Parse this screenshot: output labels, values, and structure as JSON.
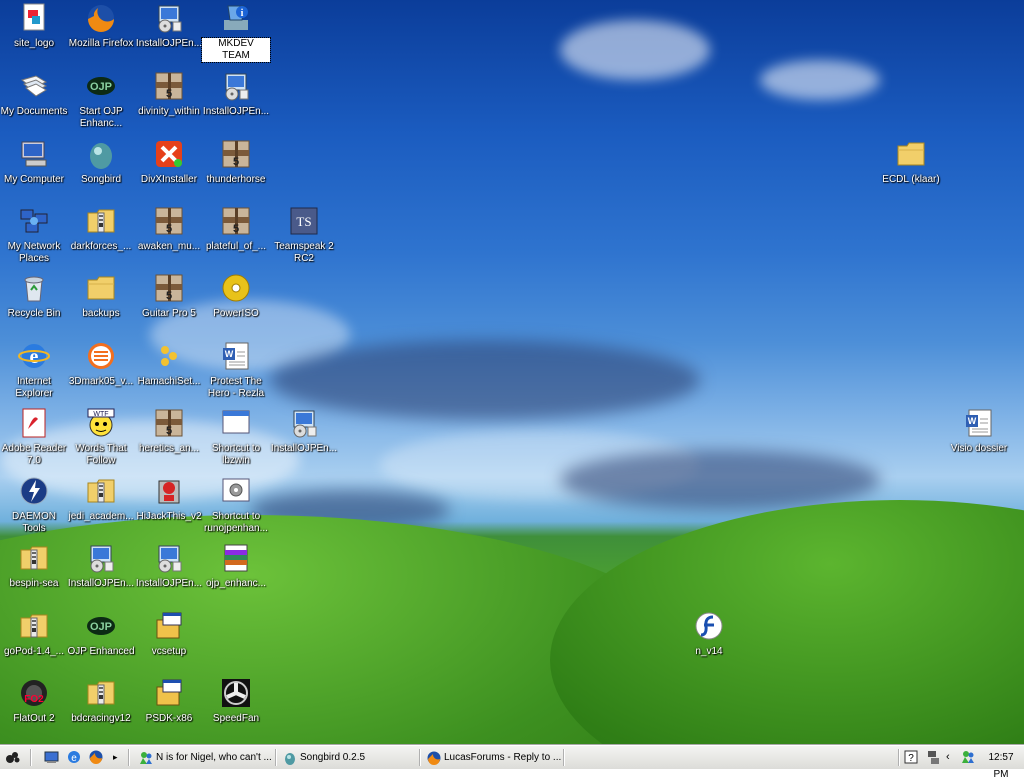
{
  "desktop": {
    "icons": [
      {
        "label": "site_logo",
        "icon": "site-logo-icon"
      },
      {
        "label": "Mozilla Firefox",
        "icon": "firefox-icon"
      },
      {
        "label": "InstallOJPEn...",
        "icon": "installer-icon"
      },
      {
        "label": "MKDEV TEAM",
        "icon": "info-icon"
      },
      {
        "label": "My Documents",
        "icon": "my-documents-icon"
      },
      {
        "label": "Start OJP Enhanc...",
        "icon": "ojp-icon"
      },
      {
        "label": "divinity_within",
        "icon": "guitar-pro-file-icon"
      },
      {
        "label": "InstallOJPEn...",
        "icon": "installer-icon"
      },
      {
        "label": "My Computer",
        "icon": "my-computer-icon"
      },
      {
        "label": "Songbird",
        "icon": "songbird-icon"
      },
      {
        "label": "DivXInstaller",
        "icon": "divx-icon"
      },
      {
        "label": "thunderhorse",
        "icon": "guitar-pro-file-icon"
      },
      {
        "label": "My Network Places",
        "icon": "network-places-icon"
      },
      {
        "label": "darkforces_...",
        "icon": "zip-folder-icon"
      },
      {
        "label": "awaken_mu...",
        "icon": "guitar-pro-file-icon"
      },
      {
        "label": "plateful_of_...",
        "icon": "guitar-pro-file-icon"
      },
      {
        "label": "Teamspeak 2 RC2",
        "icon": "teamspeak-icon"
      },
      {
        "label": "Recycle Bin",
        "icon": "recycle-bin-icon"
      },
      {
        "label": "backups",
        "icon": "folder-icon"
      },
      {
        "label": "Guitar Pro 5",
        "icon": "guitar-pro-file-icon"
      },
      {
        "label": "PowerISO",
        "icon": "poweriso-icon"
      },
      {
        "label": "Internet Explorer",
        "icon": "internet-explorer-icon"
      },
      {
        "label": "3Dmark05_v...",
        "icon": "3dmark-icon"
      },
      {
        "label": "HamachiSet...",
        "icon": "hamachi-icon"
      },
      {
        "label": "Protest The Hero - Rezla",
        "icon": "word-document-icon"
      },
      {
        "label": "Adobe Reader 7.0",
        "icon": "adobe-reader-icon"
      },
      {
        "label": "Words That Follow",
        "icon": "words-that-follow-icon"
      },
      {
        "label": "heretics_an...",
        "icon": "guitar-pro-file-icon"
      },
      {
        "label": "Shortcut to lbzwin",
        "icon": "window-shortcut-icon"
      },
      {
        "label": "InstallOJPEn...",
        "icon": "installer-icon"
      },
      {
        "label": "DAEMON Tools",
        "icon": "daemon-tools-icon"
      },
      {
        "label": "jedi_academ...",
        "icon": "zip-folder-icon"
      },
      {
        "label": "HiJackThis_v2",
        "icon": "hijackthis-icon"
      },
      {
        "label": "Shortcut to runojpenhan...",
        "icon": "settings-shortcut-icon"
      },
      {
        "label": "bespin-sea",
        "icon": "zip-folder-icon"
      },
      {
        "label": "InstallOJPEn...",
        "icon": "installer-icon"
      },
      {
        "label": "InstallOJPEn...",
        "icon": "installer-icon"
      },
      {
        "label": "ojp_enhanc...",
        "icon": "archive-icon"
      },
      {
        "label": "goPod-1.4_...",
        "icon": "zip-folder-icon"
      },
      {
        "label": "OJP Enhanced",
        "icon": "ojp-icon"
      },
      {
        "label": "vcsetup",
        "icon": "setup-icon"
      },
      {
        "label": "FlatOut 2",
        "icon": "flatout-icon"
      },
      {
        "label": "bdcracingv12",
        "icon": "zip-folder-icon"
      },
      {
        "label": "PSDK-x86",
        "icon": "setup-icon"
      },
      {
        "label": "SpeedFan",
        "icon": "speedfan-icon"
      },
      {
        "label": "ECDL (klaar)",
        "icon": "folder-icon"
      },
      {
        "label": "Visio dossier",
        "icon": "word-document-icon"
      },
      {
        "label": "n_v14",
        "icon": "flash-icon"
      }
    ]
  },
  "taskbar": {
    "tasks": [
      {
        "label": "N is for Nigel, who can't ...",
        "icon": "msn-icon"
      },
      {
        "label": "Songbird 0.2.5",
        "icon": "songbird-icon"
      },
      {
        "label": "LucasForums - Reply to ...",
        "icon": "firefox-icon"
      }
    ],
    "quick_launch": [
      "show-desktop-icon",
      "internet-explorer-icon",
      "firefox-icon"
    ],
    "tray_icons": [
      "help-icon",
      "network-icon",
      "expand-tray-icon",
      "msn-tray-icon"
    ],
    "clock": "12:57 PM"
  },
  "colors": {
    "sky_top": "#0b3d9a",
    "grass": "#4fa52f",
    "taskbar": "#e6e6e2"
  }
}
